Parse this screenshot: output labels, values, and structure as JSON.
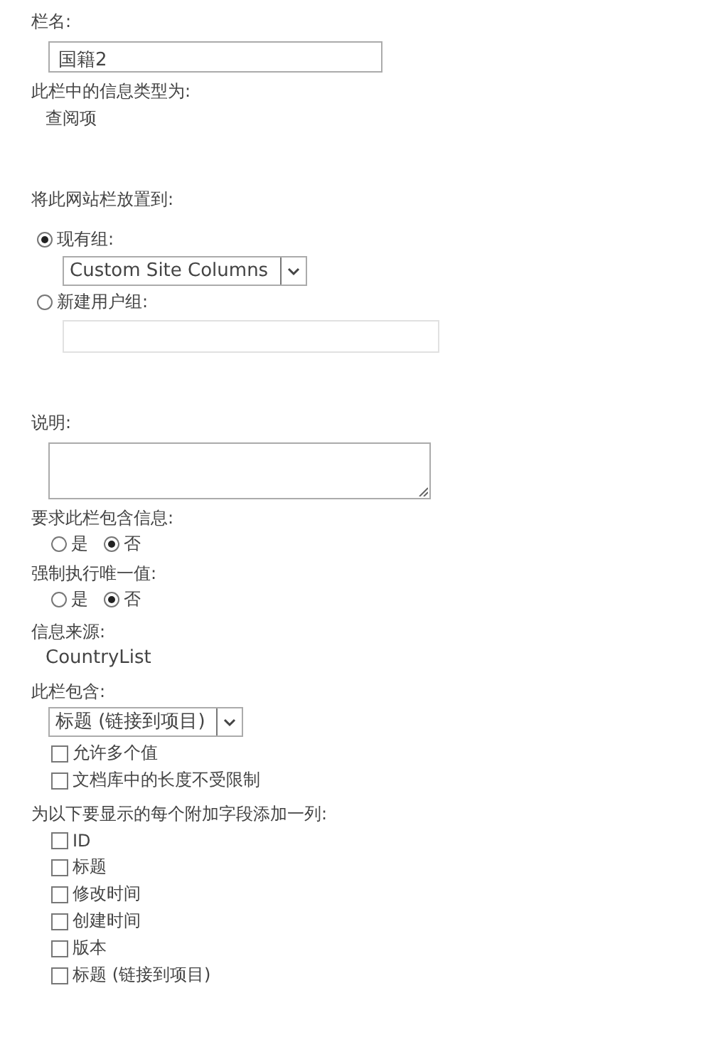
{
  "column_name": {
    "label": "栏名:",
    "value": "国籍2"
  },
  "type_info": {
    "label": "此栏中的信息类型为:",
    "value": "查阅项"
  },
  "group": {
    "label": "将此网站栏放置到:",
    "options": [
      {
        "label": "现有组:",
        "selected": true,
        "kind": "select",
        "value": "Custom Site Columns"
      },
      {
        "label": "新建用户组:",
        "selected": false,
        "kind": "input"
      }
    ]
  },
  "description": {
    "label": "说明:"
  },
  "required": {
    "label": "要求此栏包含信息:",
    "options": [
      {
        "label": "是",
        "selected": false
      },
      {
        "label": "否",
        "selected": true
      }
    ]
  },
  "unique": {
    "label": "强制执行唯一值:",
    "options": [
      {
        "label": "是",
        "selected": false
      },
      {
        "label": "否",
        "selected": true
      }
    ]
  },
  "source": {
    "label": "信息来源:",
    "value": "CountryList"
  },
  "contains": {
    "label": "此栏包含:",
    "value": "标题 (链接到项目)",
    "options": [
      {
        "label": "允许多个值",
        "checked": false
      },
      {
        "label": "文档库中的长度不受限制",
        "checked": false
      }
    ]
  },
  "additional": {
    "label": "为以下要显示的每个附加字段添加一列:",
    "fields": [
      {
        "label": "ID",
        "checked": false
      },
      {
        "label": "标题",
        "checked": false
      },
      {
        "label": "修改时间",
        "checked": false
      },
      {
        "label": "创建时间",
        "checked": false
      },
      {
        "label": "版本",
        "checked": false
      },
      {
        "label": "标题 (链接到项目)",
        "checked": false
      }
    ]
  }
}
